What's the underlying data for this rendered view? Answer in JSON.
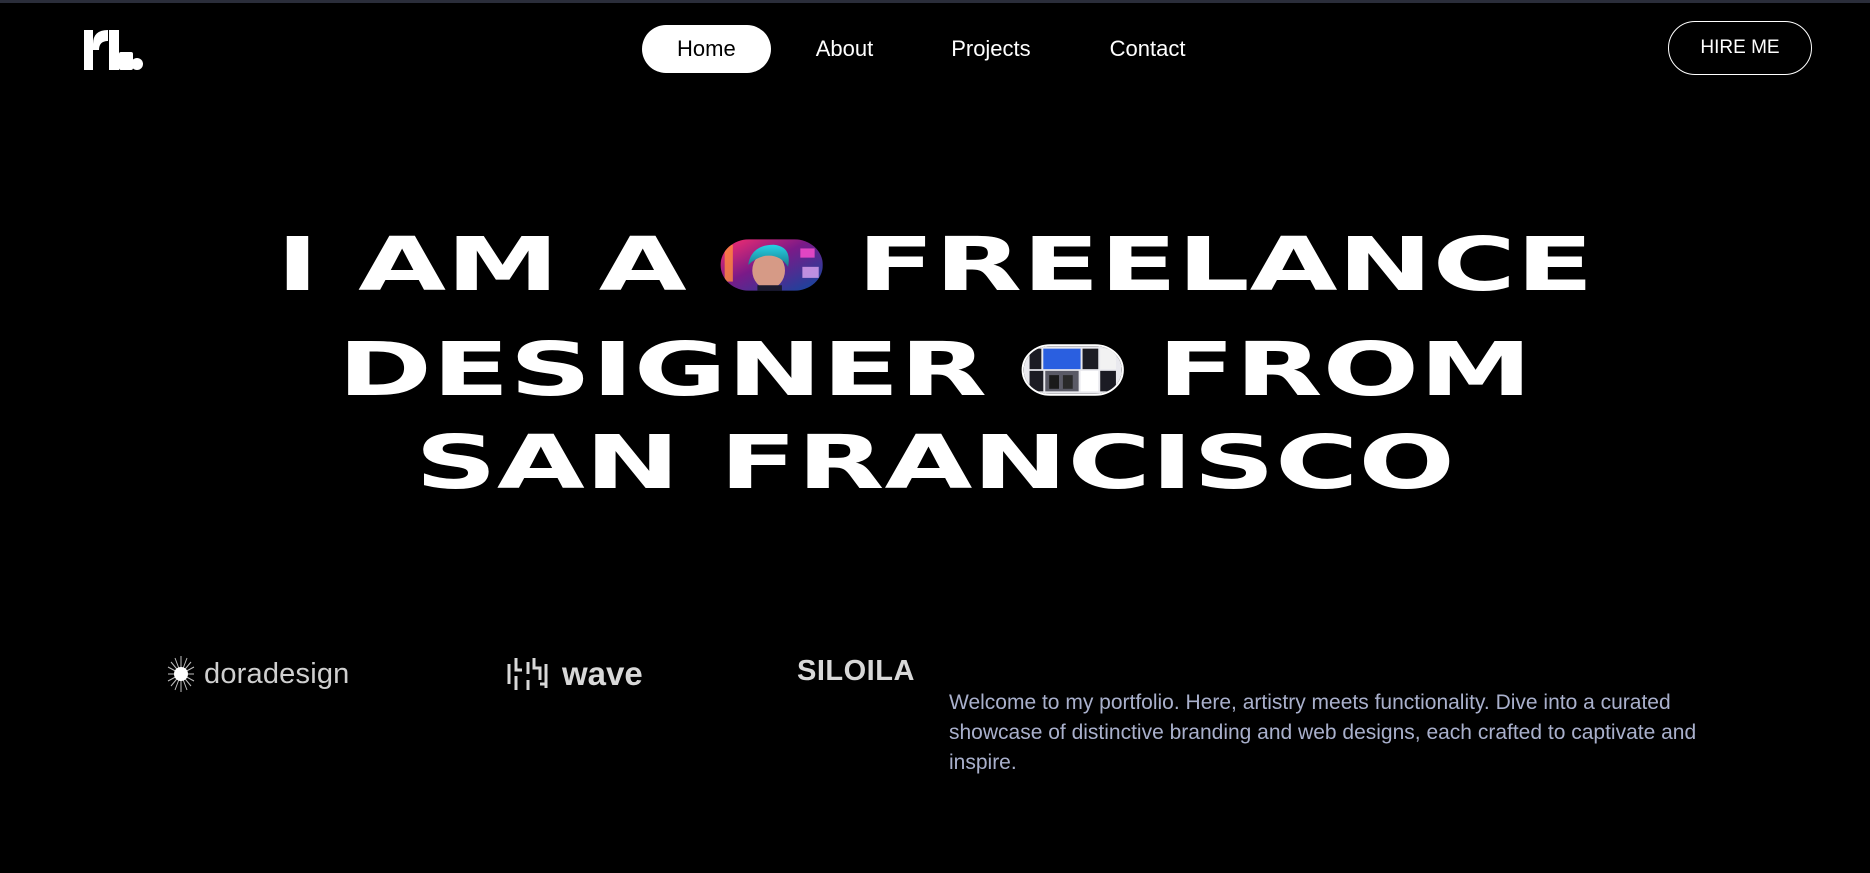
{
  "header": {
    "logo_text": "rl.",
    "nav": [
      {
        "label": "Home",
        "active": true
      },
      {
        "label": "About",
        "active": false
      },
      {
        "label": "Projects",
        "active": false
      },
      {
        "label": "Contact",
        "active": false
      }
    ],
    "hire_label": "HIRE ME"
  },
  "hero": {
    "line1": {
      "before": "I AM A",
      "after": "FREELANCE"
    },
    "line2": {
      "before": "DESIGNER",
      "after": "FROM"
    },
    "line3": "SAN FRANCISCO",
    "pill1_icon": "portrait-photo",
    "pill2_icon": "website-screens-collage"
  },
  "brands": {
    "dora": {
      "label": "doradesign",
      "icon": "starburst-icon"
    },
    "wave": {
      "label": "wave",
      "icon": "wave-mark-icon"
    },
    "silila": {
      "label": "SILOILA"
    }
  },
  "intro": "Welcome to my portfolio. Here, artistry meets functionality. Dive into a curated showcase of distinctive branding and web designs, each crafted to captivate and inspire.",
  "colors": {
    "background": "#000000",
    "text": "#ffffff",
    "intro_text": "#a9b0cc",
    "top_border": "#2a2d3a"
  }
}
